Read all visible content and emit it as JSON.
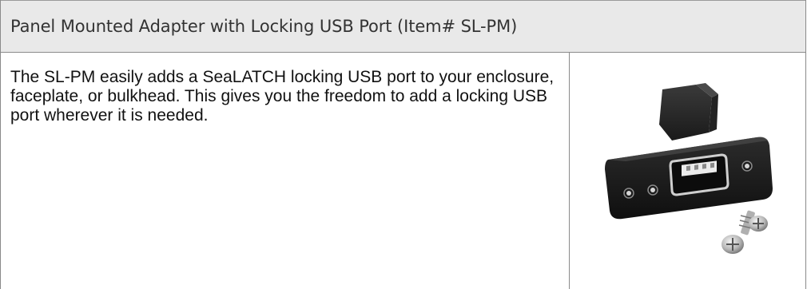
{
  "panel": {
    "title": "Panel Mounted Adapter with Locking USB Port (Item# SL-PM)",
    "description": "The SL-PM easily adds a SeaLATCH locking USB port to your enclosure, faceplate, or bulkhead. This gives you the freedom to add a locking USB port wherever it is needed.",
    "image_icon": "usb-panel-adapter-photo"
  }
}
